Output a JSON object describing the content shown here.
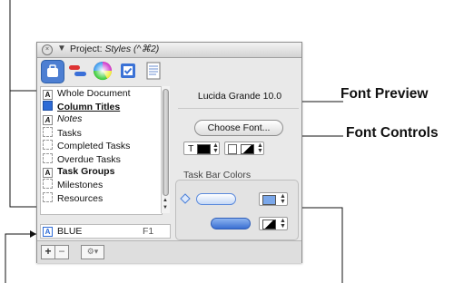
{
  "window": {
    "title_prefix": "Project: ",
    "title_italic": "Styles (^⌘2)"
  },
  "toolbar": {
    "tools": [
      "styles-icon",
      "task-bar-icon",
      "color-wheel-icon",
      "checkbox-icon",
      "notes-icon"
    ]
  },
  "style_list": [
    {
      "label": "Whole Document",
      "marker": "A",
      "style": "normal"
    },
    {
      "label": "Column Titles",
      "marker": "blue",
      "style": "bold-underline"
    },
    {
      "label": "Notes",
      "marker": "A",
      "style": "italic"
    },
    {
      "label": "Tasks",
      "marker": "dashed",
      "style": "normal"
    },
    {
      "label": "Completed Tasks",
      "marker": "dashed",
      "style": "normal"
    },
    {
      "label": "Overdue Tasks",
      "marker": "dashed",
      "style": "normal"
    },
    {
      "label": "Task Groups",
      "marker": "A",
      "style": "bold"
    },
    {
      "label": "Milestones",
      "marker": "dashed",
      "style": "normal"
    },
    {
      "label": "Resources",
      "marker": "dashed",
      "style": "normal"
    }
  ],
  "named_style": {
    "marker": "A",
    "name": "BLUE",
    "shortcut": "F1"
  },
  "bottom_bar": {
    "add": "+",
    "remove": "−",
    "gear": "⚙▾"
  },
  "inspector": {
    "font_preview": "Lucida Grande 10.0",
    "choose_font_label": "Choose Font...",
    "text_color_label": "T",
    "task_bar_colors_label": "Task Bar Colors",
    "colors": {
      "accent": "#2e6bd6",
      "bar_fill": "#6f9ee8",
      "swatch_blue": "#7aa7ea"
    }
  },
  "callouts": {
    "font_preview": "Font Preview",
    "font_controls": "Font Controls"
  }
}
